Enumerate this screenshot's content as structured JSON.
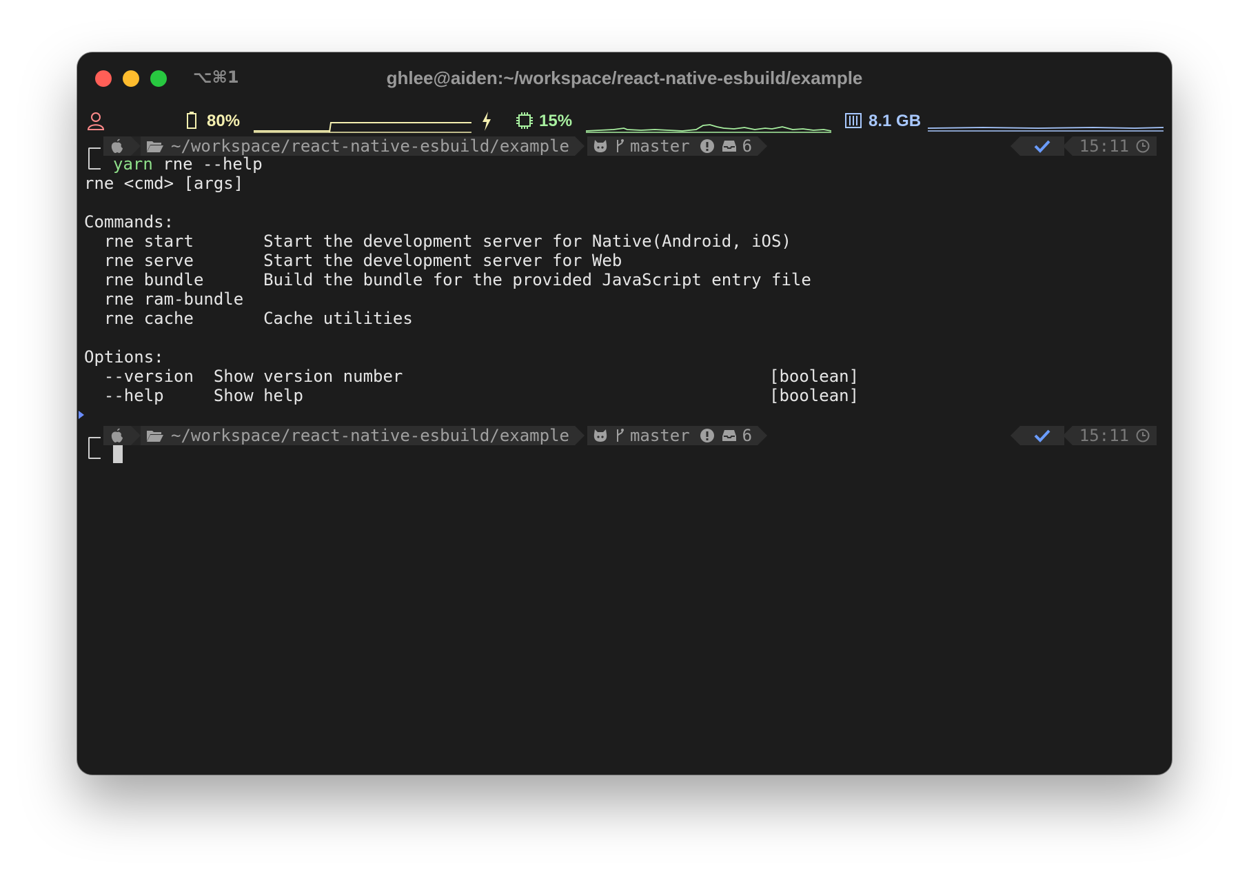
{
  "window": {
    "shortcut": "⌥⌘1",
    "title": "ghlee@aiden:~/workspace/react-native-esbuild/example"
  },
  "statusbar": {
    "battery": "80%",
    "cpu": "15%",
    "memory": "8.1 GB",
    "colors": {
      "battery": "#f5f0b0",
      "cpu": "#a8f0a0",
      "memory": "#a8c8ff"
    }
  },
  "prompt": {
    "path": "~/workspace/react-native-esbuild/example",
    "branch": "master",
    "stash_count": "6",
    "time": "15:11",
    "status_icon": "check-icon"
  },
  "command": {
    "program": "yarn",
    "args": " rne --help"
  },
  "output": {
    "usage": "rne <cmd> [args]",
    "commands_header": "Commands:",
    "commands": [
      {
        "name": "  rne start       ",
        "desc": "Start the development server for Native(Android, iOS)"
      },
      {
        "name": "  rne serve       ",
        "desc": "Start the development server for Web"
      },
      {
        "name": "  rne bundle      ",
        "desc": "Build the bundle for the provided JavaScript entry file"
      },
      {
        "name": "  rne ram-bundle",
        "desc": ""
      },
      {
        "name": "  rne cache       ",
        "desc": "Cache utilities"
      }
    ],
    "options_header": "Options:",
    "options": [
      {
        "name": "  --version  ",
        "desc": "Show version number",
        "type": "[boolean]"
      },
      {
        "name": "  --help     ",
        "desc": "Show help",
        "type": "[boolean]"
      }
    ]
  }
}
